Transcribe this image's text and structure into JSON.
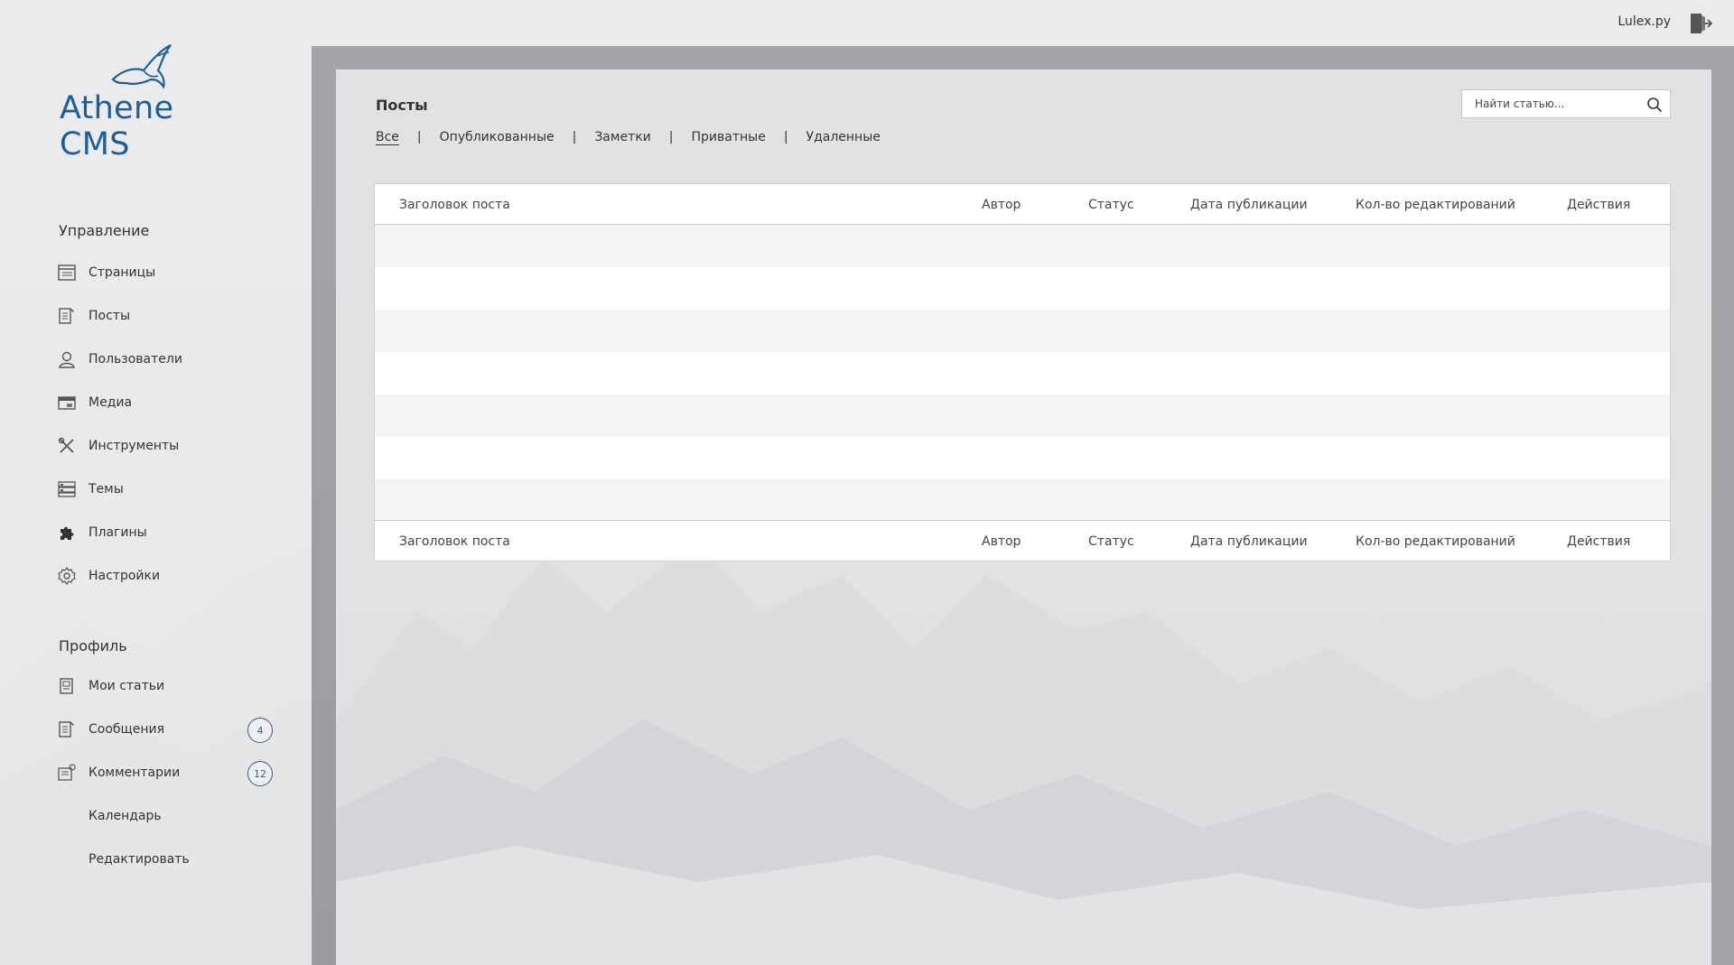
{
  "app": {
    "brand": "Athene CMS",
    "accent_color": "#1d5e96"
  },
  "topbar": {
    "username": "Lulex.py",
    "logout_icon": "logout-icon"
  },
  "sidebar": {
    "management_title": "Управление",
    "management_items": [
      {
        "label": "Страницы",
        "icon": "pages-icon"
      },
      {
        "label": "Посты",
        "icon": "posts-icon"
      },
      {
        "label": "Пользователи",
        "icon": "user-icon"
      },
      {
        "label": "Медиа",
        "icon": "media-icon"
      },
      {
        "label": "Инструменты",
        "icon": "tools-icon"
      },
      {
        "label": "Темы",
        "icon": "themes-icon"
      },
      {
        "label": "Плагины",
        "icon": "puzzle-icon"
      },
      {
        "label": "Настройки",
        "icon": "gear-icon"
      }
    ],
    "profile_title": "Профиль",
    "profile_items": [
      {
        "label": "Мои статьи",
        "icon": "articles-icon"
      },
      {
        "label": "Сообщения",
        "icon": "messages-icon",
        "badge": "4"
      },
      {
        "label": "Комментарии",
        "icon": "comments-icon",
        "badge": "12"
      },
      {
        "label": "Календарь"
      },
      {
        "label": "Редактировать"
      }
    ]
  },
  "main": {
    "title": "Посты",
    "filters": [
      "Все",
      "Опубликованные",
      "Заметки",
      "Приватные",
      "Удаленные"
    ],
    "active_filter": "Все",
    "search_placeholder": "Найти статью...",
    "table": {
      "columns": [
        "Заголовок поста",
        "Автор",
        "Статус",
        "Дата публикации",
        "Кол-во редактирований",
        "Действия"
      ],
      "row_count": 7
    }
  }
}
